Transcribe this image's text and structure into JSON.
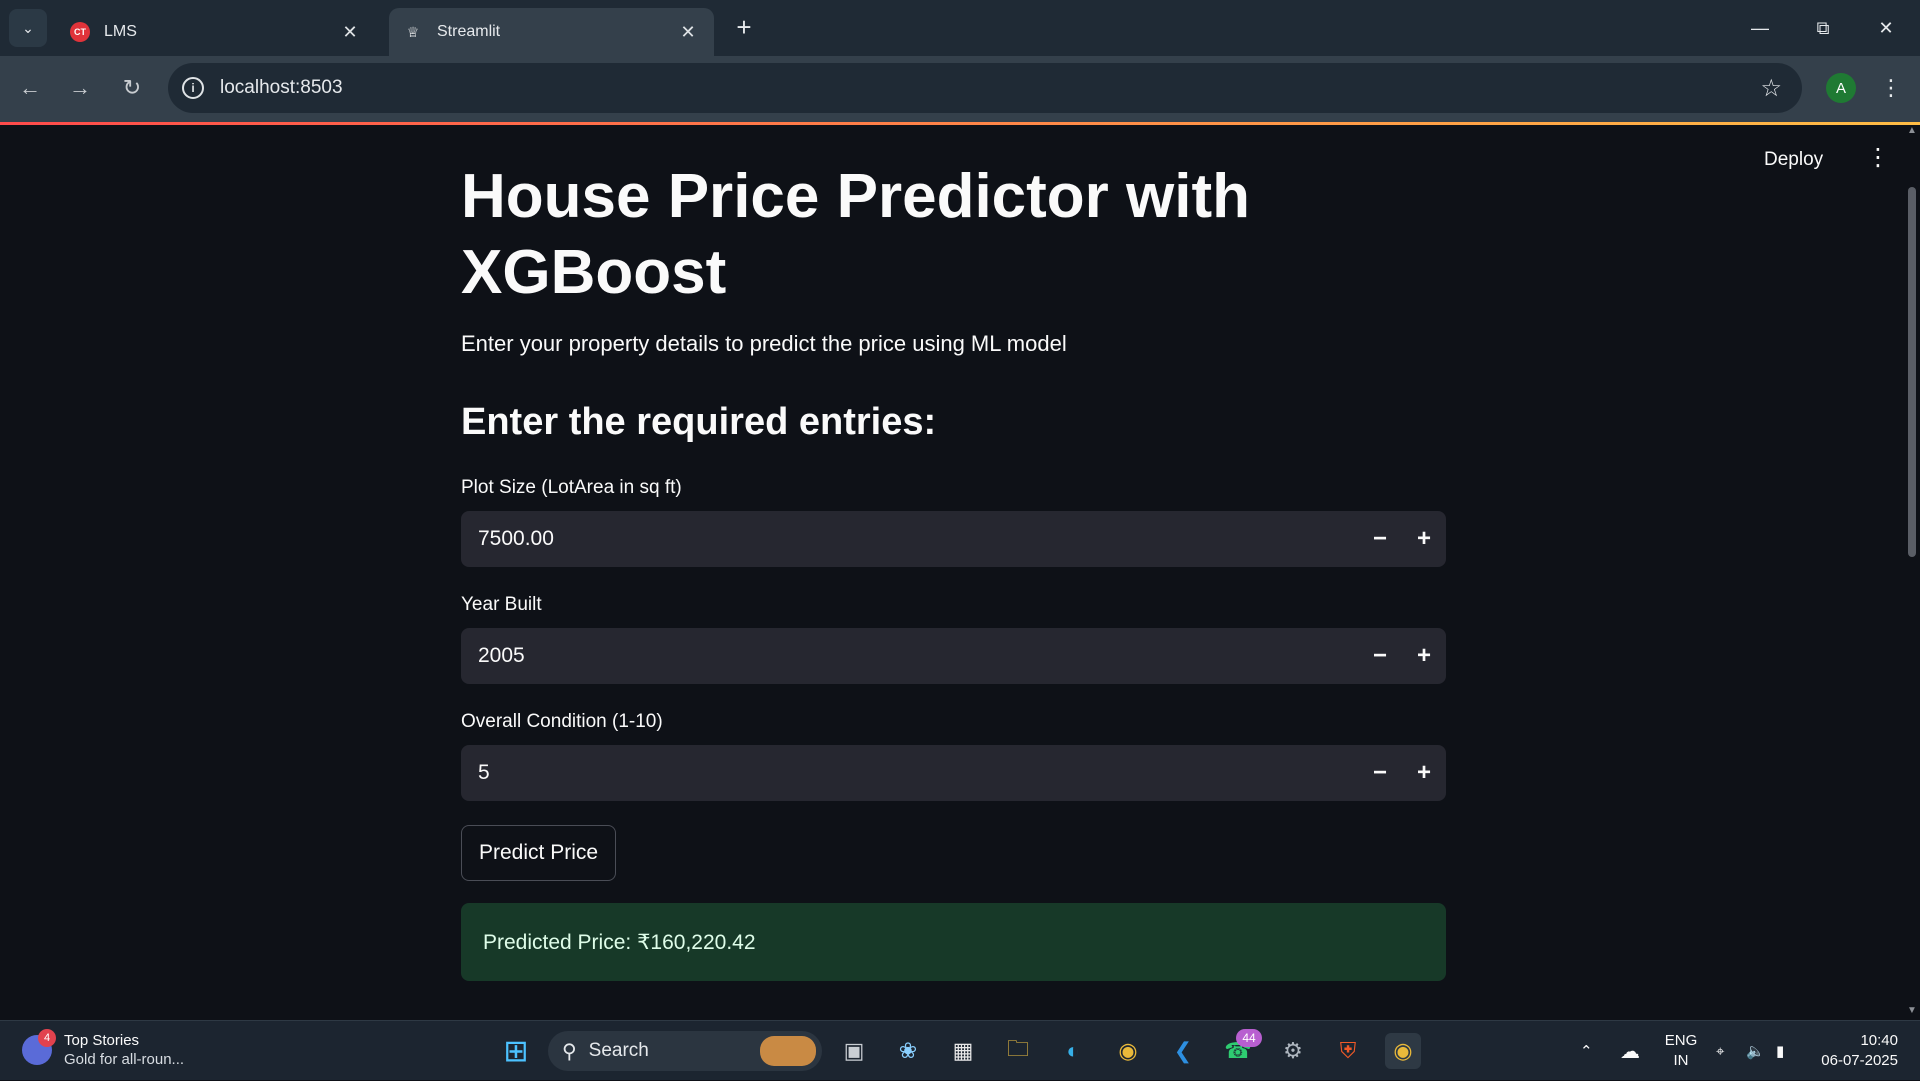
{
  "browser": {
    "tabs": [
      {
        "label": "LMS",
        "favicon": "lms-icon",
        "active": false
      },
      {
        "label": "Streamlit",
        "favicon": "streamlit-icon",
        "active": true
      }
    ],
    "url": "localhost:8503",
    "profile_initial": "A"
  },
  "app": {
    "deploy_label": "Deploy",
    "title": "House Price Predictor with XGBoost",
    "subtitle": "Enter your property details to predict the price using ML model",
    "section_heading": "Enter the required entries:",
    "inputs": [
      {
        "label": "Plot Size (LotArea in sq ft)",
        "value": "7500.00"
      },
      {
        "label": "Year Built",
        "value": "2005"
      },
      {
        "label": "Overall Condition (1-10)",
        "value": "5"
      }
    ],
    "predict_button": "Predict Price",
    "result": "Predicted Price: ₹160,220.42",
    "colors": {
      "background": "#0e1117",
      "input_bg": "#262730",
      "success_bg": "#173928",
      "accent": "#ff4b4b"
    }
  },
  "taskbar": {
    "news_title": "Top Stories",
    "news_subtitle": "Gold for all-roun...",
    "news_badge": "4",
    "search_label": "Search",
    "whatsapp_badge": "44",
    "language_top": "ENG",
    "language_bottom": "IN",
    "time": "10:40",
    "date": "06-07-2025"
  }
}
